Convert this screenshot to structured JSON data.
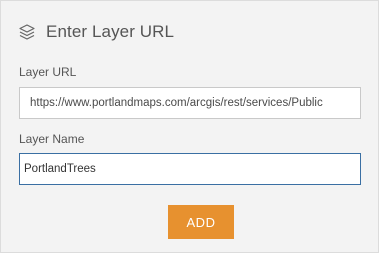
{
  "header": {
    "title": "Enter Layer URL",
    "icon": "layers-icon"
  },
  "form": {
    "url_label": "Layer URL",
    "url_value": "https://www.portlandmaps.com/arcgis/rest/services/Public",
    "name_label": "Layer Name",
    "name_value": "PortlandTrees"
  },
  "actions": {
    "add_label": "ADD"
  },
  "colors": {
    "panel_background": "#f3f3f3",
    "accent": "#e7912f",
    "focus_border": "#3a6fa3"
  }
}
